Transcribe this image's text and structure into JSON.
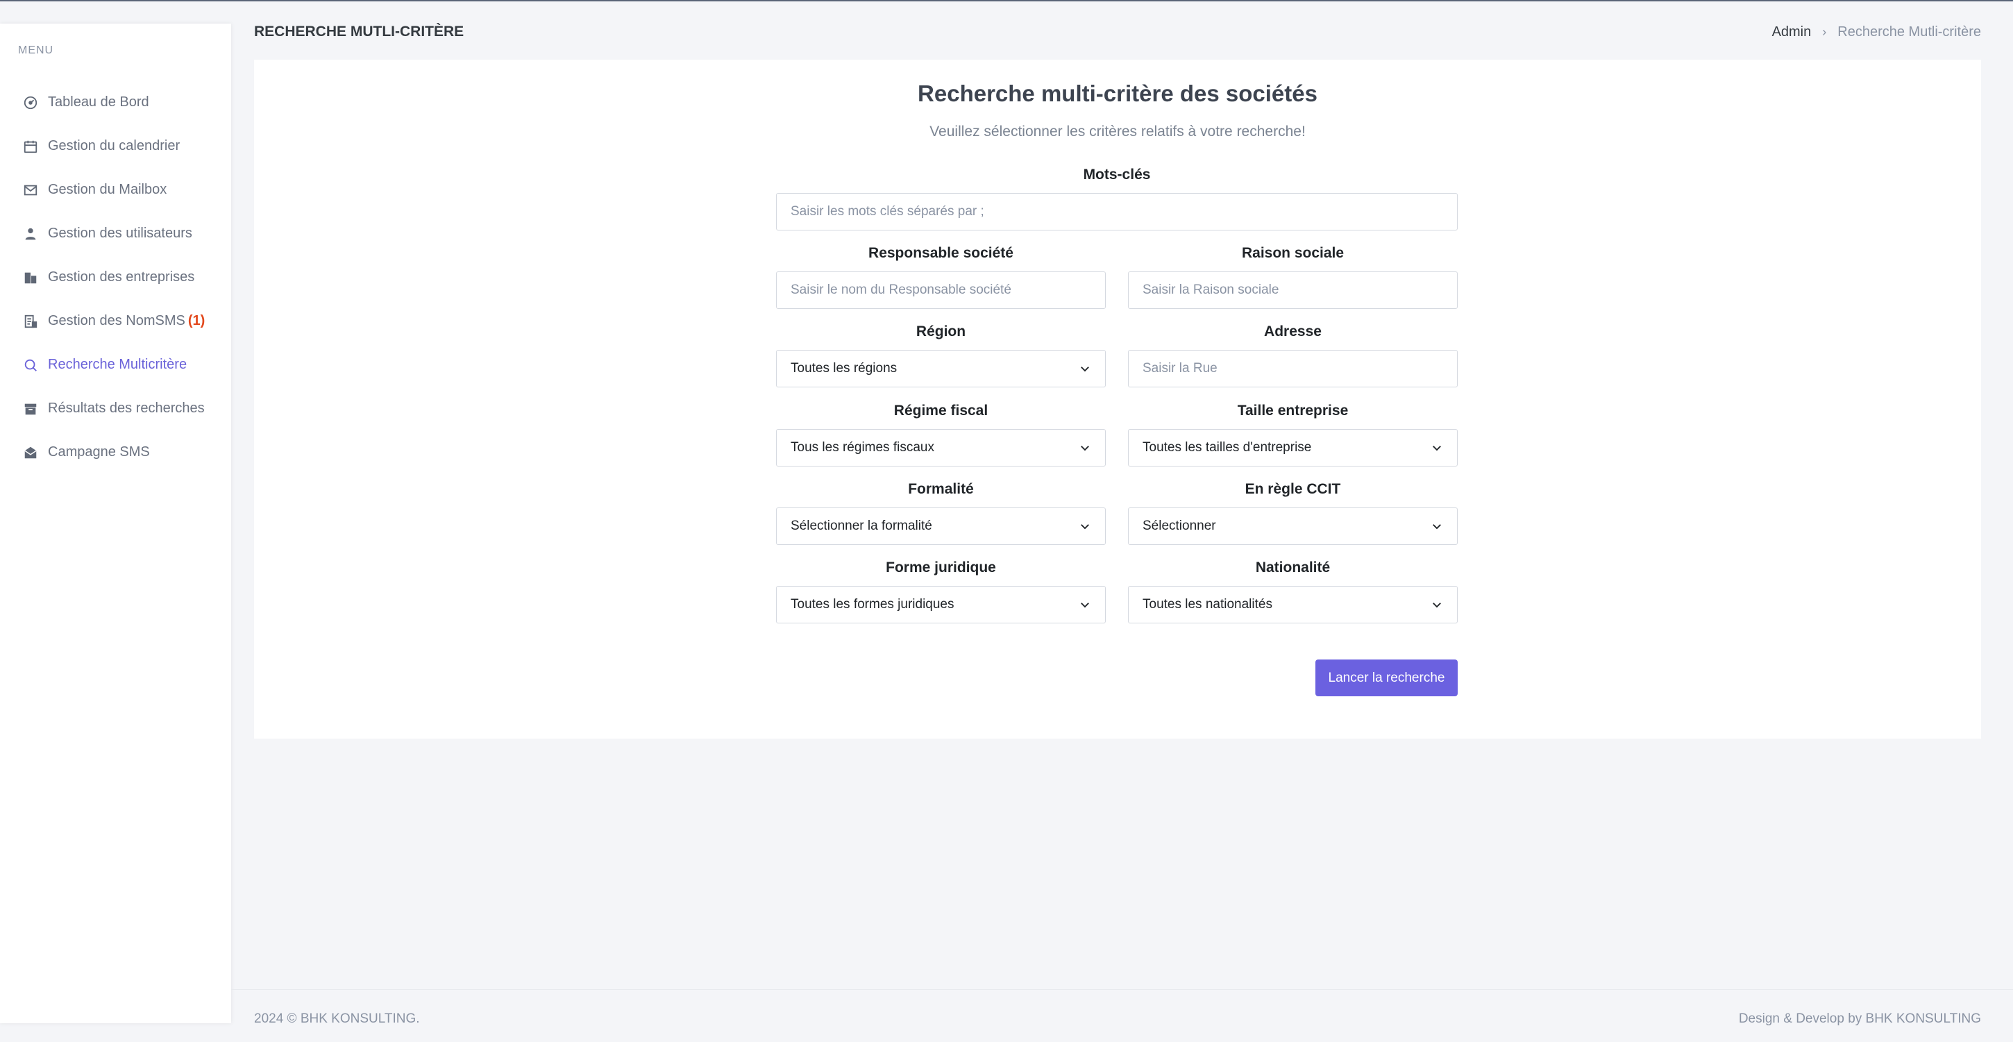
{
  "sidebar": {
    "menu_title": "MENU",
    "items": [
      {
        "label": "Tableau de Bord",
        "icon": "dashboard-icon"
      },
      {
        "label": "Gestion du calendrier",
        "icon": "calendar-icon"
      },
      {
        "label": "Gestion du Mailbox",
        "icon": "mailbox-icon"
      },
      {
        "label": "Gestion des utilisateurs",
        "icon": "user-icon"
      },
      {
        "label": "Gestion des entreprises",
        "icon": "building-icon"
      },
      {
        "label": "Gestion des NomSMS",
        "badge": "(1)",
        "icon": "sms-list-icon"
      },
      {
        "label": "Recherche Multicritère",
        "icon": "search-icon",
        "active": true
      },
      {
        "label": "Résultats des recherches",
        "icon": "archive-icon"
      },
      {
        "label": "Campagne SMS",
        "icon": "open-mail-icon"
      }
    ],
    "active_color": "#6a62d9",
    "badge_color": "#e2481c"
  },
  "header": {
    "title": "RECHERCHE MUTLI-CRITÈRE",
    "breadcrumb": {
      "home": "Admin",
      "current": "Recherche Mutli-critère"
    }
  },
  "form": {
    "title": "Recherche multi-critère des sociétés",
    "subtitle": "Veuillez sélectionner les critères relatifs à votre recherche!",
    "keywords": {
      "label": "Mots-clés",
      "placeholder": "Saisir les mots clés séparés par ;"
    },
    "responsable": {
      "label": "Responsable société",
      "placeholder": "Saisir le nom du Responsable société"
    },
    "raison_sociale": {
      "label": "Raison sociale",
      "placeholder": "Saisir la Raison sociale"
    },
    "region": {
      "label": "Région",
      "value": "Toutes les régions"
    },
    "adresse": {
      "label": "Adresse",
      "placeholder": "Saisir la Rue"
    },
    "regime_fiscal": {
      "label": "Régime fiscal",
      "value": "Tous les régimes fiscaux"
    },
    "taille": {
      "label": "Taille entreprise",
      "value": "Toutes les tailles d'entreprise"
    },
    "formalite": {
      "label": "Formalité",
      "value": "Sélectionner la formalité"
    },
    "ccit": {
      "label": "En règle CCIT",
      "value": "Sélectionner"
    },
    "forme_juridique": {
      "label": "Forme juridique",
      "value": "Toutes les formes juridiques"
    },
    "nationalite": {
      "label": "Nationalité",
      "value": "Toutes les nationalités"
    },
    "submit_label": "Lancer la recherche",
    "button_color": "#6b61e0"
  },
  "footer": {
    "left": "2024 © BHK KONSULTING.",
    "right": "Design & Develop by BHK KONSULTING"
  }
}
